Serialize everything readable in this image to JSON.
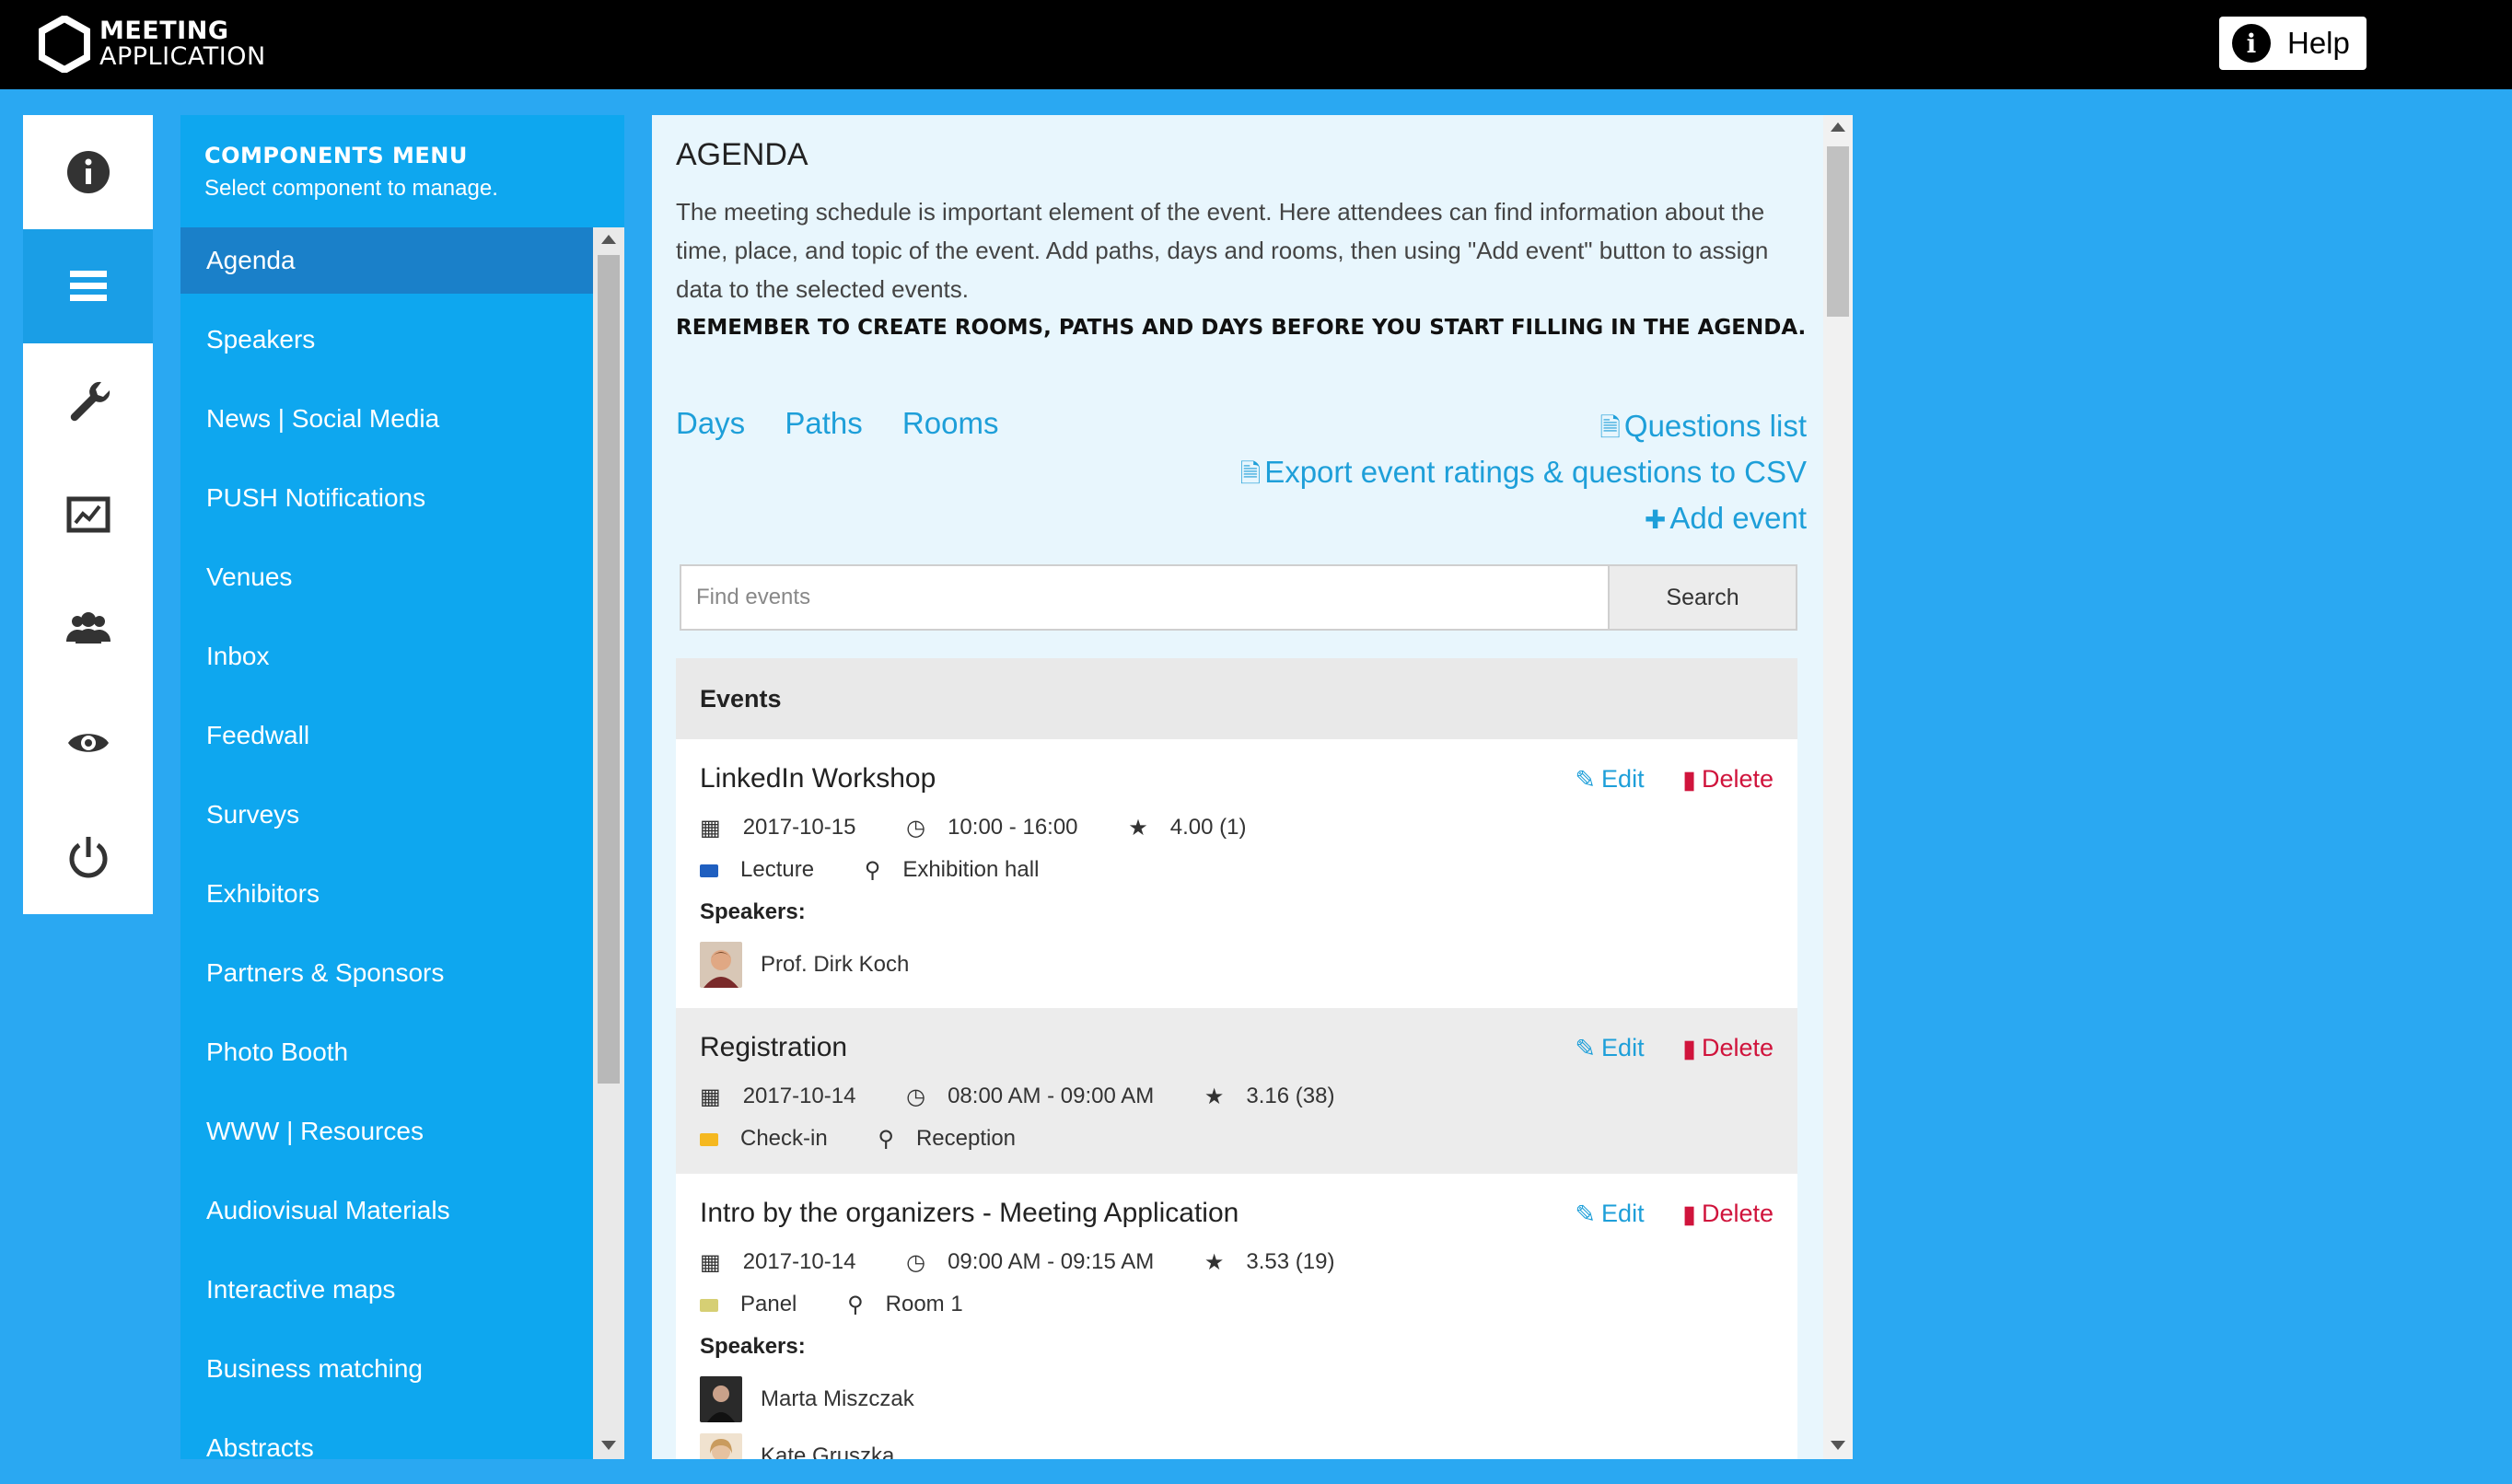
{
  "header": {
    "logo_line1": "MEETING",
    "logo_line2": "APPLICATION",
    "help_label": "Help",
    "help_icon": "info-icon"
  },
  "iconbar": {
    "items": [
      {
        "name": "info-icon"
      },
      {
        "name": "menu-icon",
        "active": true
      },
      {
        "name": "wrench-icon"
      },
      {
        "name": "chart-icon"
      },
      {
        "name": "users-icon"
      },
      {
        "name": "eye-icon"
      },
      {
        "name": "power-icon"
      }
    ]
  },
  "components_menu": {
    "title": "COMPONENTS MENU",
    "subtitle": "Select component to manage.",
    "items": [
      "Agenda",
      "Speakers",
      "News | Social Media",
      "PUSH Notifications",
      "Venues",
      "Inbox",
      "Feedwall",
      "Surveys",
      "Exhibitors",
      "Partners & Sponsors",
      "Photo Booth",
      "WWW | Resources",
      "Audiovisual Materials",
      "Interactive maps",
      "Business matching",
      "Abstracts"
    ],
    "active_index": 0
  },
  "agenda": {
    "title": "AGENDA",
    "intro": "The meeting schedule is important element of the event. Here attendees can find information about the time, place, and topic of the event. Add paths, days and rooms, then using \"Add event\" button to assign data to the selected events.",
    "warning": "REMEMBER TO CREATE ROOMS, PATHS AND DAYS BEFORE YOU START FILLING IN THE AGENDA.",
    "links_left": [
      "Days",
      "Paths",
      "Rooms"
    ],
    "questions_list": "Questions list",
    "export_csv": "Export event ratings & questions to CSV",
    "add_event": "Add event",
    "search_placeholder": "Find events",
    "search_button": "Search",
    "events_header": "Events",
    "edit_label": "Edit",
    "delete_label": "Delete",
    "speakers_label": "Speakers:",
    "events": [
      {
        "title": "LinkedIn Workshop",
        "date": "2017-10-15",
        "time": "10:00 - 16:00",
        "rating": "4.00 (1)",
        "path": "Lecture",
        "path_color": "#1f5fc0",
        "room": "Exhibition hall",
        "speakers": [
          "Prof. Dirk Koch"
        ]
      },
      {
        "title": "Registration",
        "date": "2017-10-14",
        "time": "08:00 AM - 09:00 AM",
        "rating": "3.16 (38)",
        "path": "Check-in",
        "path_color": "#f5b820",
        "room": "Reception",
        "speakers": []
      },
      {
        "title": "Intro by the organizers - Meeting Application",
        "date": "2017-10-14",
        "time": "09:00 AM - 09:15 AM",
        "rating": "3.53 (19)",
        "path": "Panel",
        "path_color": "#d6cf74",
        "room": "Room 1",
        "speakers": [
          "Marta Miszczak",
          "Kate Gruszka"
        ]
      }
    ]
  }
}
